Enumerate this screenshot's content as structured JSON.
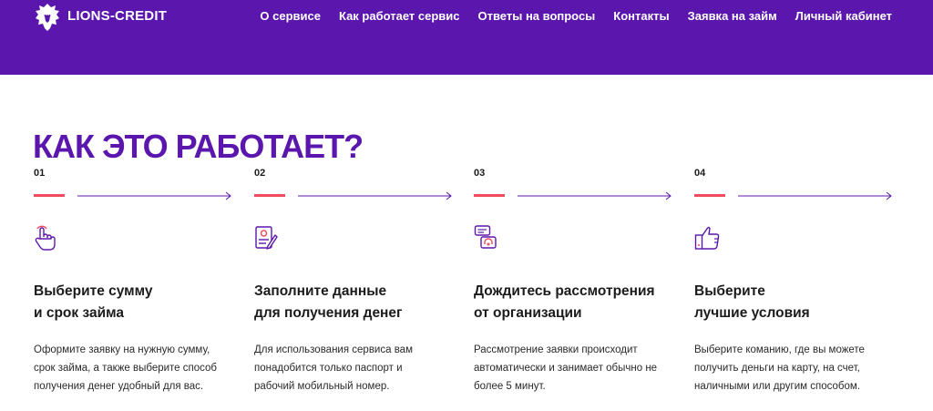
{
  "header": {
    "logo_text": "LIONS-CREDIT",
    "nav": [
      "О сервисе",
      "Как работает сервис",
      "Ответы на вопросы",
      "Контакты",
      "Заявка на займ",
      "Личный кабинет"
    ]
  },
  "section": {
    "title": "КАК ЭТО РАБОТАЕТ?",
    "steps": [
      {
        "number": "01",
        "icon": "hand-pointer-icon",
        "title_line1": "Выберите сумму",
        "title_line2": "и срок займа",
        "desc_line1": "Оформите заявку на нужную сумму,",
        "desc_line2": "срок займа, а также выберите способ",
        "desc_line3": "получения денег удобный для вас."
      },
      {
        "number": "02",
        "icon": "document-form-icon",
        "title_line1": "Заполните данные",
        "title_line2": "для получения денег",
        "desc_line1": "Для использования сервиса вам",
        "desc_line2": "понадобится только паспорт и",
        "desc_line3": "рабочий мобильный номер."
      },
      {
        "number": "03",
        "icon": "support-chat-icon",
        "title_line1": "Дождитесь рассмотрения",
        "title_line2": "от организации",
        "desc_line1": "Рассмотрение заявки происходит",
        "desc_line2": "автоматически и занимает обычно не",
        "desc_line3": "более 5 минут."
      },
      {
        "number": "04",
        "icon": "thumbs-up-icon",
        "title_line1": "Выберите",
        "title_line2": "лучшие условия",
        "desc_line1": "Выберите команию, где вы можете",
        "desc_line2": "получить деньги на карту, на счет,",
        "desc_line3": "наличными или другим способом."
      }
    ]
  },
  "colors": {
    "brand_purple": "#5b17ad",
    "accent_red": "#f04b5e",
    "text": "#1b1b1b"
  }
}
